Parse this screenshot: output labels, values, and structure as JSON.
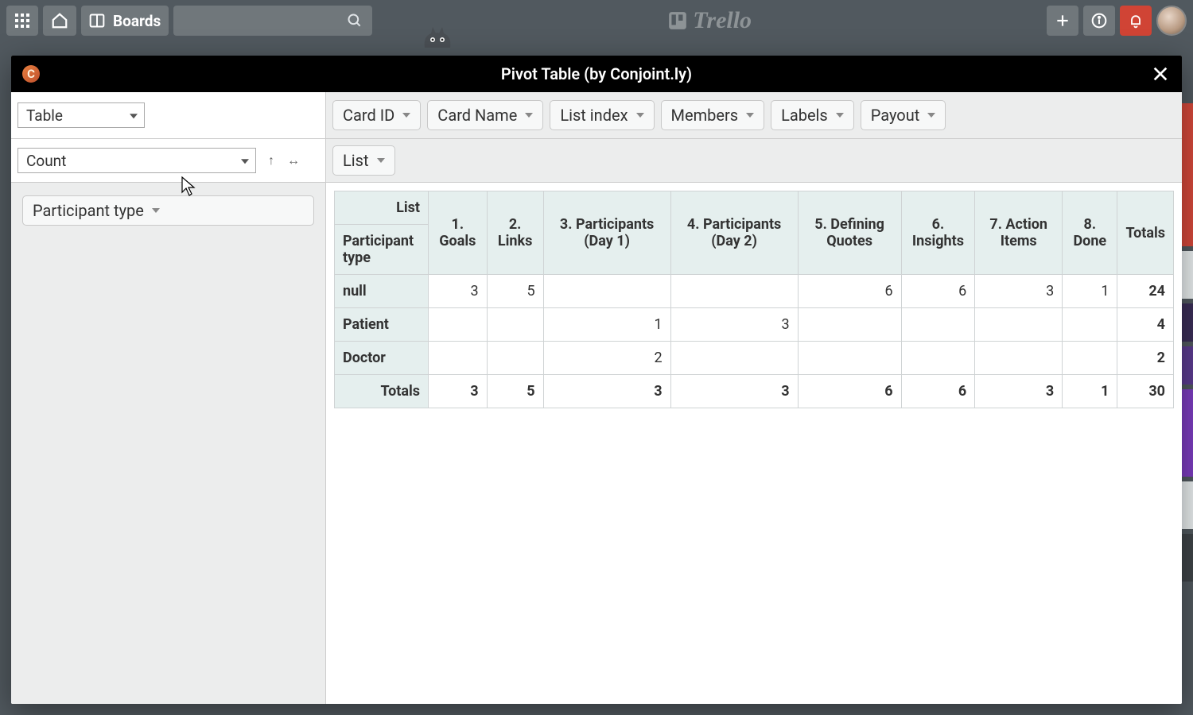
{
  "header": {
    "boards_label": "Boards",
    "brand": "Trello"
  },
  "modal": {
    "title": "Pivot Table (by Conjoint.ly)",
    "icon_letter": "C"
  },
  "controls": {
    "renderer": "Table",
    "aggregator": "Count",
    "column_attr": "List",
    "row_attr": "Participant type",
    "unused_attrs": [
      "Card ID",
      "Card Name",
      "List index",
      "Members",
      "Labels",
      "Payout"
    ]
  },
  "pivot": {
    "col_dim_label": "List",
    "row_dim_label": "Participant type",
    "columns": [
      "1. Goals",
      "2. Links",
      "3. Participants (Day 1)",
      "4. Participants (Day 2)",
      "5. Defining Quotes",
      "6. Insights",
      "7. Action Items",
      "8. Done"
    ],
    "rows": [
      {
        "label": "null",
        "values": [
          "3",
          "5",
          "",
          "",
          "6",
          "6",
          "3",
          "1"
        ],
        "total": "24"
      },
      {
        "label": "Patient",
        "values": [
          "",
          "",
          "1",
          "3",
          "",
          "",
          "",
          ""
        ],
        "total": "4"
      },
      {
        "label": "Doctor",
        "values": [
          "",
          "",
          "2",
          "",
          "",
          "",
          "",
          ""
        ],
        "total": "2"
      }
    ],
    "col_totals": [
      "3",
      "5",
      "3",
      "3",
      "6",
      "6",
      "3",
      "1"
    ],
    "grand_total": "30",
    "totals_label": "Totals"
  }
}
